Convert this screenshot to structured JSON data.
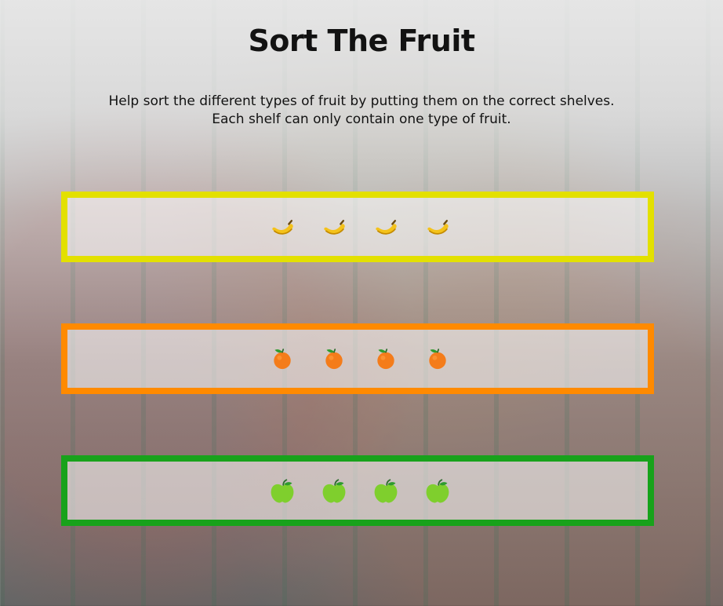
{
  "game": {
    "title": "Sort The Fruit",
    "instructions": {
      "line1": "Help sort the different types of fruit by putting them on the correct shelves.",
      "line2": "Each shelf can only contain one type of fruit."
    },
    "shelves": [
      {
        "name": "banana-shelf",
        "border_color": "#e3e000",
        "fruit": "banana",
        "count": 4
      },
      {
        "name": "orange-shelf",
        "border_color": "#ff8a00",
        "fruit": "orange",
        "count": 4
      },
      {
        "name": "apple-shelf",
        "border_color": "#18a21b",
        "fruit": "green-apple",
        "count": 4
      }
    ],
    "icons": {
      "banana": "banana-icon",
      "orange": "orange-icon",
      "apple": "green-apple-icon"
    }
  }
}
